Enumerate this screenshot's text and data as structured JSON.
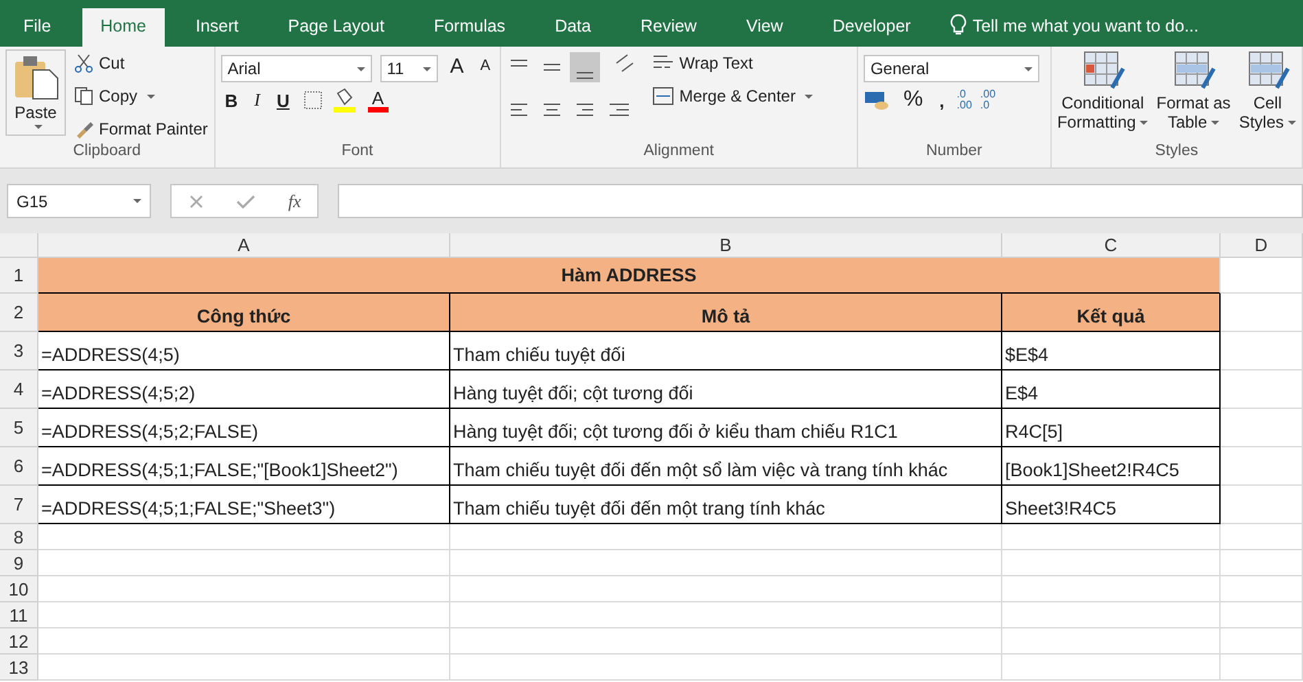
{
  "tabs": [
    {
      "label": "File",
      "selected": false
    },
    {
      "label": "Home",
      "selected": true
    },
    {
      "label": "Insert",
      "selected": false
    },
    {
      "label": "Page Layout",
      "selected": false
    },
    {
      "label": "Formulas",
      "selected": false
    },
    {
      "label": "Data",
      "selected": false
    },
    {
      "label": "Review",
      "selected": false
    },
    {
      "label": "View",
      "selected": false
    },
    {
      "label": "Developer",
      "selected": false
    }
  ],
  "tell_me": {
    "placeholder": "Tell me what you want to do..."
  },
  "ribbon": {
    "clipboard": {
      "label": "Clipboard",
      "paste": "Paste",
      "cut": "Cut",
      "copy": "Copy",
      "format_painter": "Format Painter"
    },
    "font": {
      "label": "Font",
      "font_name": "Arial",
      "font_size": "11",
      "grow": "A",
      "shrink": "A",
      "bold": "B",
      "italic": "I",
      "underline": "U",
      "font_color": "A"
    },
    "alignment": {
      "label": "Alignment",
      "wrap_text": "Wrap Text",
      "merge_center": "Merge & Center"
    },
    "number": {
      "label": "Number",
      "format": "General",
      "percent": "%",
      "comma": ",",
      "increase_decimal": [
        ".0",
        ".00"
      ],
      "decrease_decimal": [
        ".00",
        ".0"
      ]
    },
    "styles": {
      "label": "Styles",
      "items": [
        [
          "Conditional",
          "Formatting"
        ],
        [
          "Format as",
          "Table"
        ],
        [
          "Cell",
          "Styles"
        ]
      ]
    }
  },
  "formula_bar": {
    "name_box": "G15",
    "fx": "fx"
  },
  "sheet": {
    "columns": [
      "A",
      "B",
      "C",
      "D"
    ],
    "rows": [
      {
        "number": "1",
        "kind": "title",
        "cells": [
          "Hàm ADDRESS"
        ]
      },
      {
        "number": "2",
        "kind": "header",
        "cells": [
          "Công thức",
          "Mô tả",
          "Kết quả"
        ]
      },
      {
        "number": "3",
        "kind": "data",
        "cells": [
          "=ADDRESS(4;5)",
          "Tham chiếu tuyệt đối",
          "$E$4"
        ]
      },
      {
        "number": "4",
        "kind": "data",
        "cells": [
          "=ADDRESS(4;5;2)",
          "Hàng tuyệt đối; cột tương đối",
          "E$4"
        ]
      },
      {
        "number": "5",
        "kind": "data",
        "cells": [
          "=ADDRESS(4;5;2;FALSE)",
          "Hàng tuyệt đối; cột tương đối ở kiểu tham chiếu R1C1",
          "R4C[5]"
        ]
      },
      {
        "number": "6",
        "kind": "data",
        "cells": [
          "=ADDRESS(4;5;1;FALSE;\"[Book1]Sheet2\")",
          "Tham chiếu tuyệt đối đến một sổ làm việc và trang tính khác",
          "[Book1]Sheet2!R4C5"
        ]
      },
      {
        "number": "7",
        "kind": "data",
        "cells": [
          "=ADDRESS(4;5;1;FALSE;\"Sheet3\")",
          "Tham chiếu tuyệt đối đến một trang tính khác",
          "Sheet3!R4C5"
        ]
      },
      {
        "number": "8",
        "kind": "empty"
      },
      {
        "number": "9",
        "kind": "empty"
      },
      {
        "number": "10",
        "kind": "empty"
      },
      {
        "number": "11",
        "kind": "empty"
      },
      {
        "number": "12",
        "kind": "empty"
      },
      {
        "number": "13",
        "kind": "empty"
      }
    ]
  }
}
